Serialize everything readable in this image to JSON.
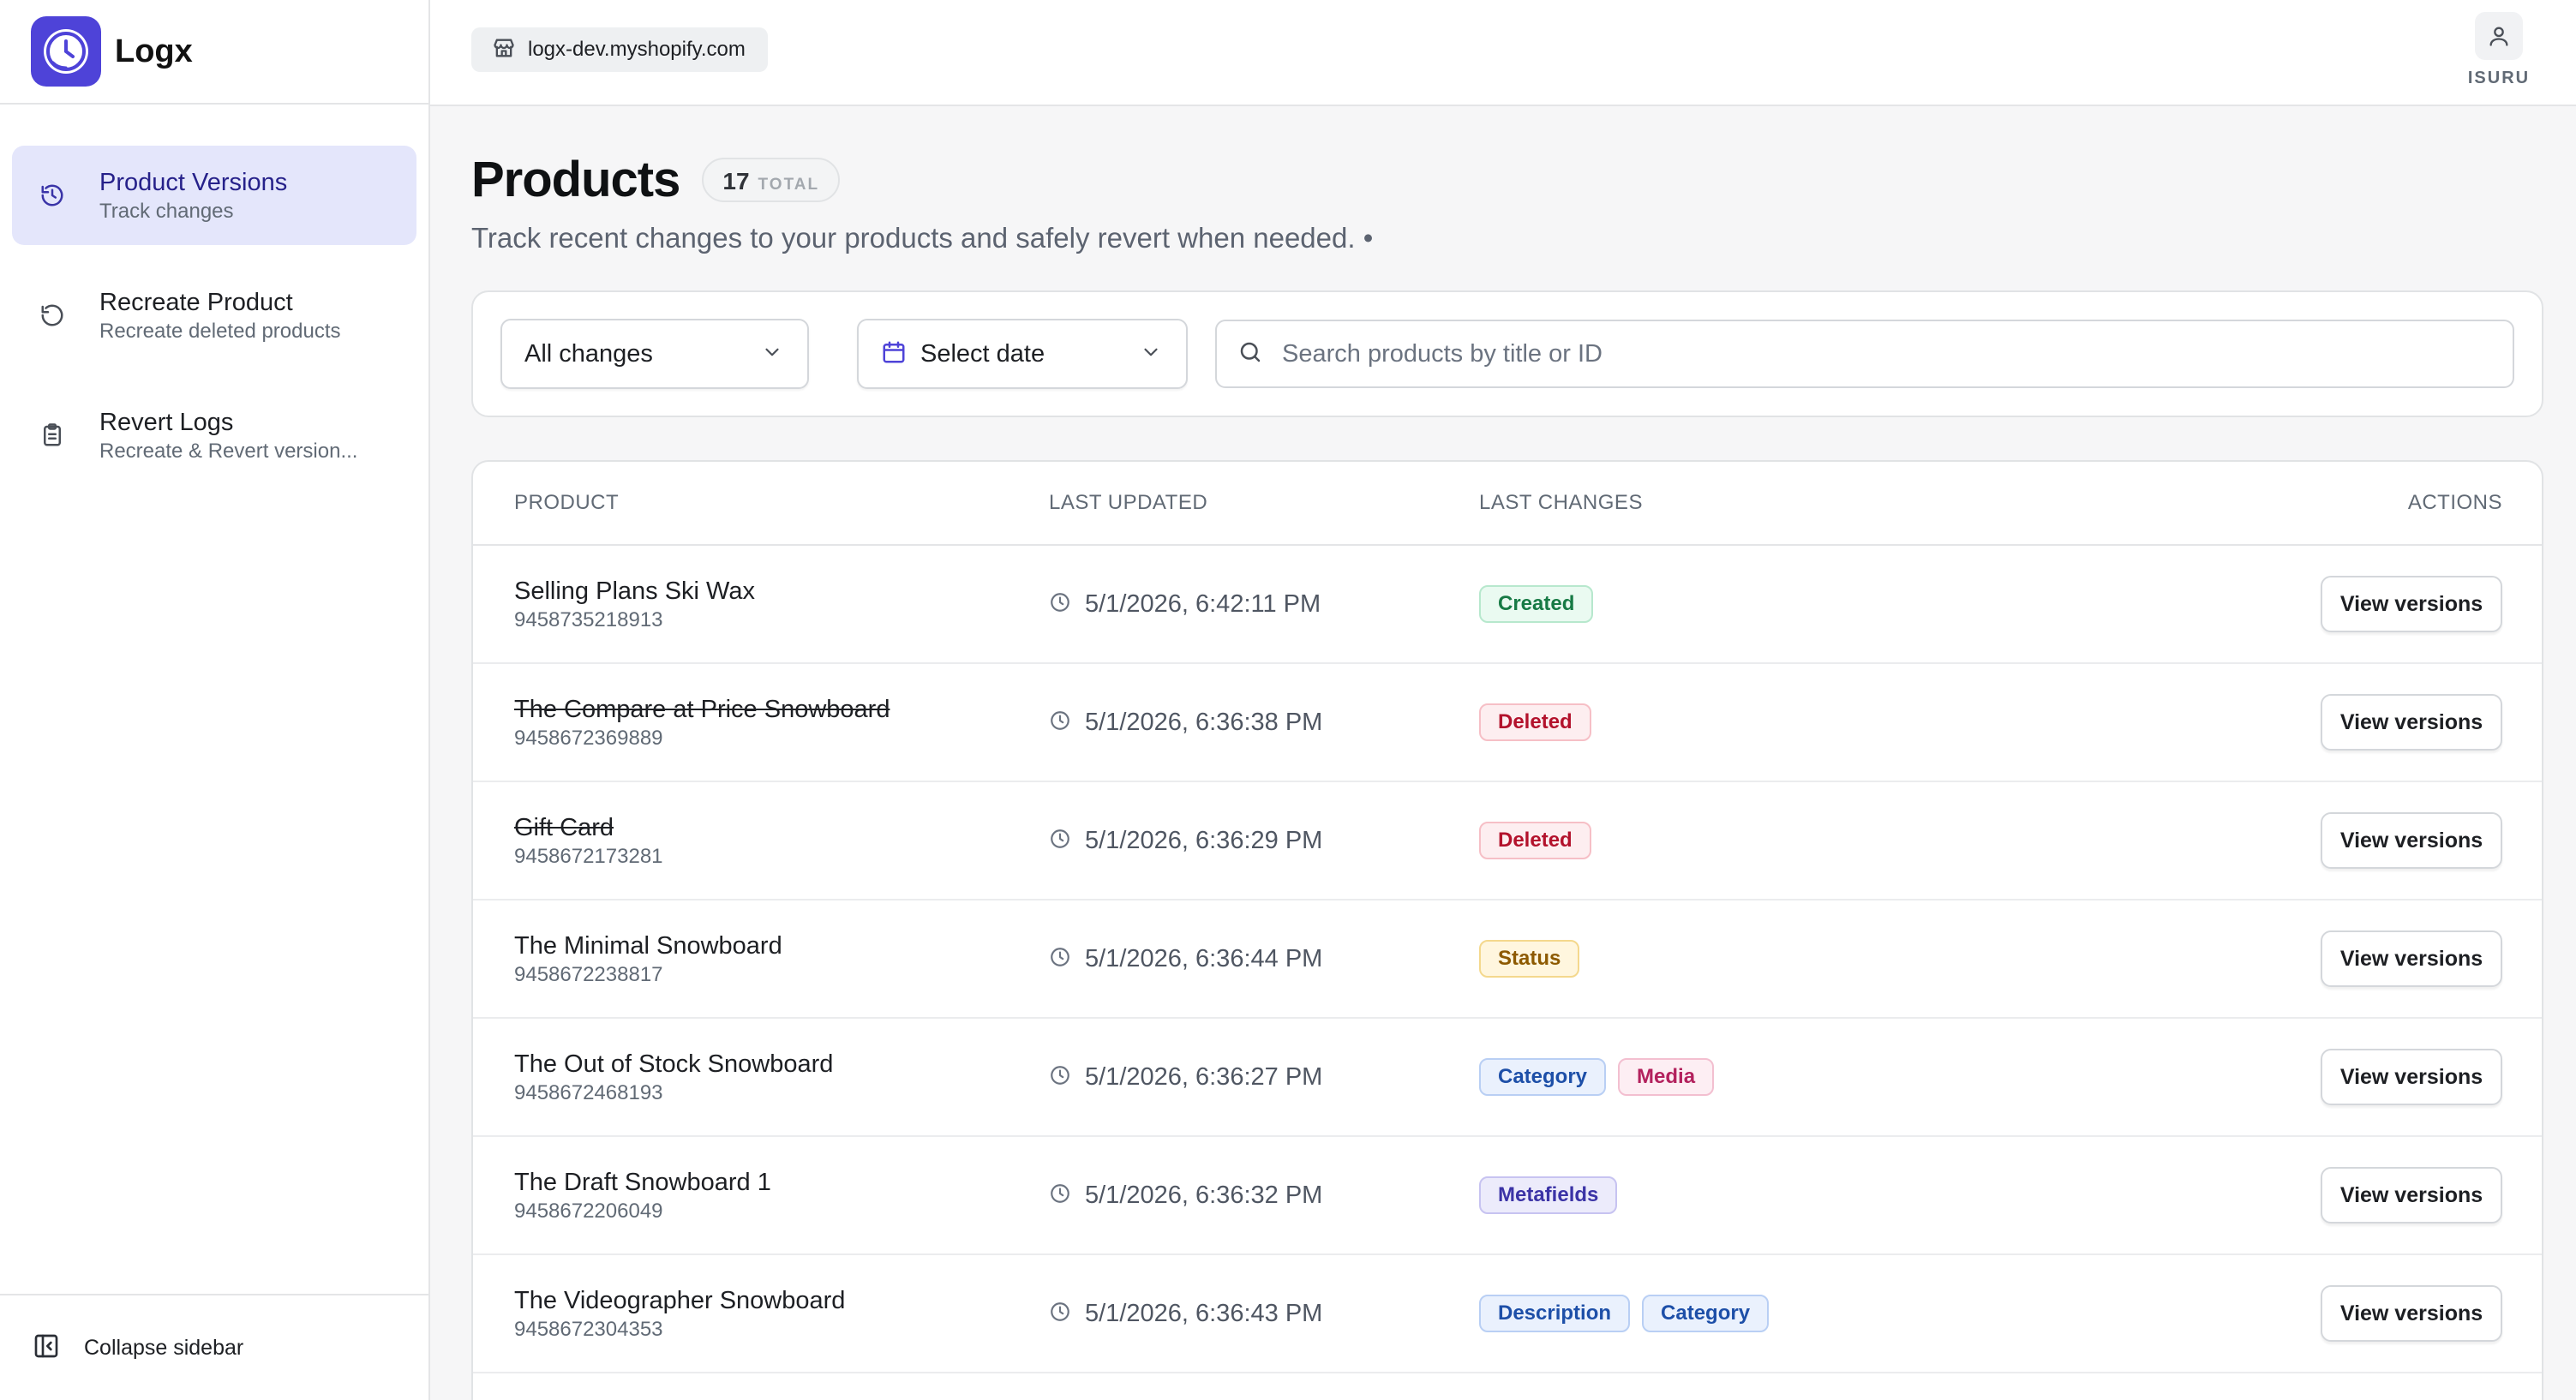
{
  "app": {
    "name": "Logx"
  },
  "sidebar": {
    "items": [
      {
        "title": "Product Versions",
        "subtitle": "Track changes",
        "icon": "history-icon",
        "active": true
      },
      {
        "title": "Recreate Product",
        "subtitle": "Recreate deleted products",
        "icon": "rotate-ccw-icon",
        "active": false
      },
      {
        "title": "Revert Logs",
        "subtitle": "Recreate & Revert version...",
        "icon": "clipboard-icon",
        "active": false
      }
    ],
    "collapse_label": "Collapse sidebar"
  },
  "topbar": {
    "store": "logx-dev.myshopify.com",
    "user": "ISURU"
  },
  "page": {
    "title": "Products",
    "total_count": "17",
    "total_label": "TOTAL",
    "description": "Track recent changes to your products and safely revert when needed. •"
  },
  "filters": {
    "change_filter": "All changes",
    "date_filter": "Select date",
    "search_placeholder": "Search products by title or ID"
  },
  "table": {
    "headers": {
      "product": "PRODUCT",
      "last_updated": "LAST UPDATED",
      "last_changes": "LAST CHANGES",
      "actions": "ACTIONS"
    },
    "action_label": "View versions",
    "rows": [
      {
        "name": "Selling Plans Ski Wax",
        "id": "9458735218913",
        "updated": "5/1/2026, 6:42:11 PM",
        "deleted": false,
        "changes": [
          {
            "label": "Created",
            "kind": "created"
          }
        ]
      },
      {
        "name": "The Compare at Price Snowboard",
        "id": "9458672369889",
        "updated": "5/1/2026, 6:36:38 PM",
        "deleted": true,
        "changes": [
          {
            "label": "Deleted",
            "kind": "deleted"
          }
        ]
      },
      {
        "name": "Gift Card",
        "id": "9458672173281",
        "updated": "5/1/2026, 6:36:29 PM",
        "deleted": true,
        "changes": [
          {
            "label": "Deleted",
            "kind": "deleted"
          }
        ]
      },
      {
        "name": "The Minimal Snowboard",
        "id": "9458672238817",
        "updated": "5/1/2026, 6:36:44 PM",
        "deleted": false,
        "changes": [
          {
            "label": "Status",
            "kind": "status"
          }
        ]
      },
      {
        "name": "The Out of Stock Snowboard",
        "id": "9458672468193",
        "updated": "5/1/2026, 6:36:27 PM",
        "deleted": false,
        "changes": [
          {
            "label": "Category",
            "kind": "category"
          },
          {
            "label": "Media",
            "kind": "media"
          }
        ]
      },
      {
        "name": "The Draft Snowboard 1",
        "id": "9458672206049",
        "updated": "5/1/2026, 6:36:32 PM",
        "deleted": false,
        "changes": [
          {
            "label": "Metafields",
            "kind": "metafields"
          }
        ]
      },
      {
        "name": "The Videographer Snowboard",
        "id": "9458672304353",
        "updated": "5/1/2026, 6:36:43 PM",
        "deleted": false,
        "changes": [
          {
            "label": "Description",
            "kind": "description"
          },
          {
            "label": "Category",
            "kind": "category"
          }
        ]
      }
    ]
  },
  "colors": {
    "brand": "#4e43d8",
    "active_nav_bg": "#e4e6fb",
    "page_bg": "#f6f6f7"
  }
}
